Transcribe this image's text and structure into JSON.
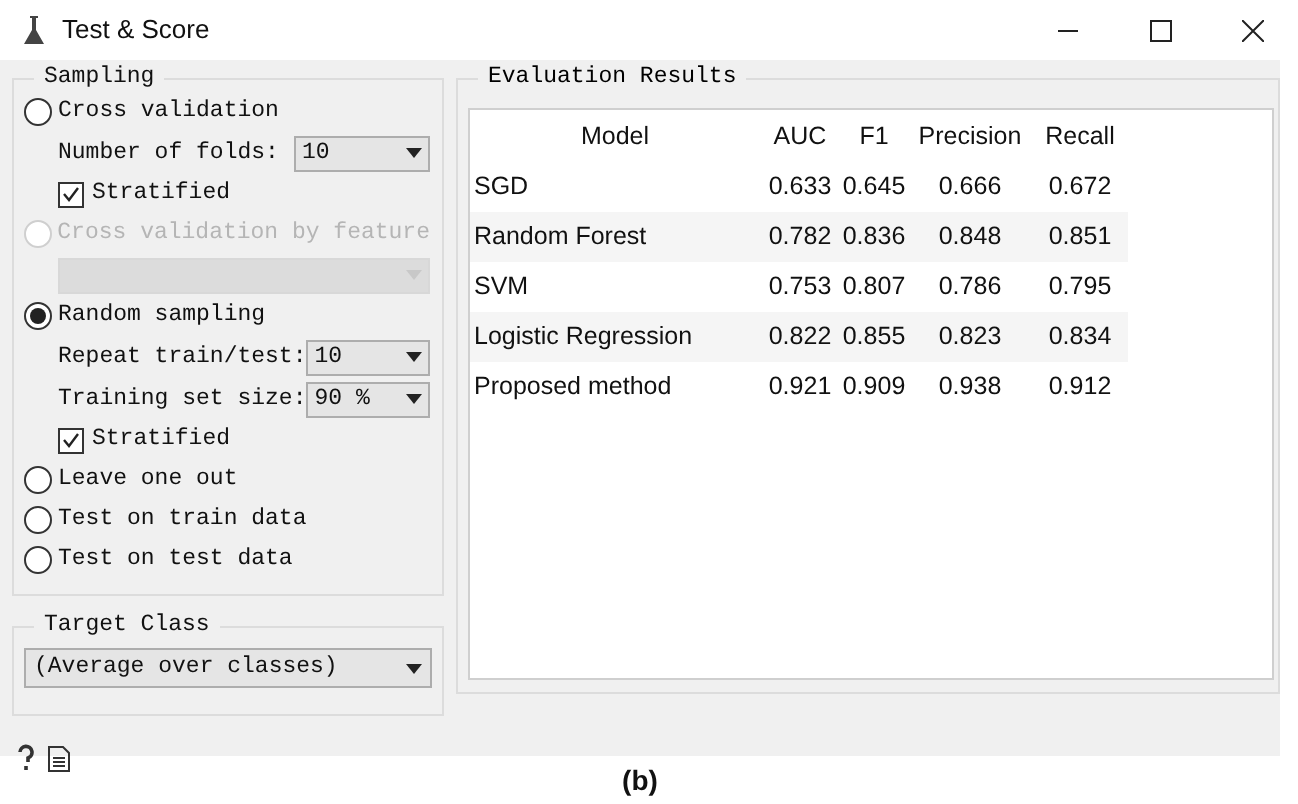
{
  "window": {
    "title": "Test & Score"
  },
  "sampling": {
    "title": "Sampling",
    "options": [
      {
        "kind": "radio",
        "label": "Cross validation",
        "selected": false,
        "disabled": false
      },
      {
        "kind": "dropdown",
        "label": "Number of folds:",
        "value": "10",
        "disabled": false
      },
      {
        "kind": "checkbox",
        "label": "Stratified",
        "checked": true
      },
      {
        "kind": "radio",
        "label": "Cross validation by feature",
        "selected": false,
        "disabled": true
      },
      {
        "kind": "dropdown",
        "disabled": true
      },
      {
        "kind": "radio",
        "label": "Random sampling",
        "selected": true,
        "disabled": false
      },
      {
        "kind": "dropdown",
        "label": "Repeat train/test:",
        "value": "10",
        "disabled": false
      },
      {
        "kind": "dropdown",
        "label": "Training set size:",
        "value": "90 %",
        "disabled": false
      },
      {
        "kind": "checkbox",
        "label": "Stratified",
        "checked": true
      },
      {
        "kind": "radio",
        "label": "Leave one out",
        "selected": false,
        "disabled": false
      },
      {
        "kind": "radio",
        "label": "Test on train data",
        "selected": false,
        "disabled": false
      },
      {
        "kind": "radio",
        "label": "Test on test data",
        "selected": false,
        "disabled": false
      }
    ]
  },
  "target_class": {
    "title": "Target Class",
    "value": "(Average over classes)"
  },
  "results": {
    "title": "Evaluation Results",
    "columns": [
      "Model",
      "AUC",
      "F1",
      "Precision",
      "Recall"
    ],
    "rows": [
      [
        "SGD",
        "0.633",
        "0.645",
        "0.666",
        "0.672"
      ],
      [
        "Random Forest",
        "0.782",
        "0.836",
        "0.848",
        "0.851"
      ],
      [
        "SVM",
        "0.753",
        "0.807",
        "0.786",
        "0.795"
      ],
      [
        "Logistic Regression",
        "0.822",
        "0.855",
        "0.823",
        "0.834"
      ],
      [
        "Proposed method",
        "0.921",
        "0.909",
        "0.938",
        "0.912"
      ]
    ]
  },
  "caption": "(b)"
}
